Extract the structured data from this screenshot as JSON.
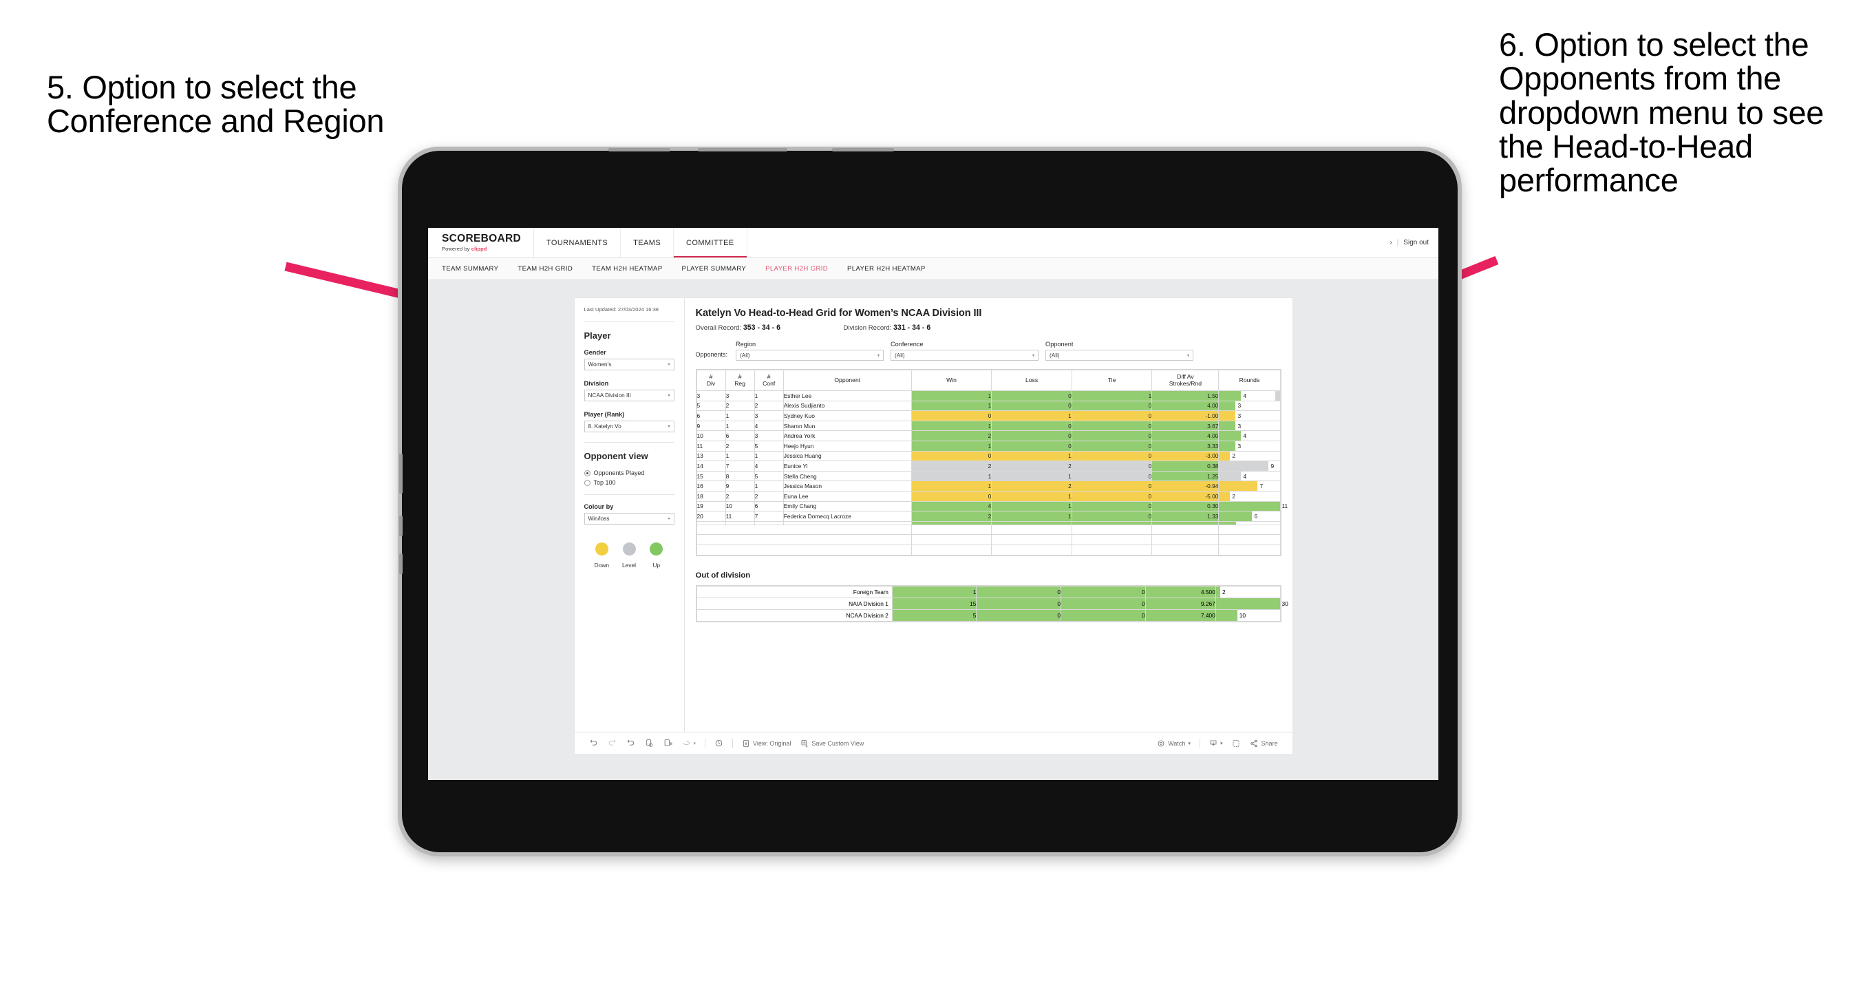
{
  "annotations": {
    "left": "5. Option to select the Conference and Region",
    "right": "6. Option to select the Opponents from the dropdown menu to see the Head-to-Head performance",
    "arrow_color": "#e8225f"
  },
  "appbar": {
    "brand_name": "SCOREBOARD",
    "brand_sub_prefix": "Powered by ",
    "brand_sub_accent": "clippd",
    "nav": [
      {
        "label": "TOURNAMENTS",
        "active": false
      },
      {
        "label": "TEAMS",
        "active": false
      },
      {
        "label": "COMMITTEE",
        "active": true
      }
    ],
    "chevron": "›",
    "separator": "|",
    "signout": "Sign out",
    "accent": "#d12b4e"
  },
  "subnav": {
    "items": [
      {
        "label": "TEAM SUMMARY",
        "active": false
      },
      {
        "label": "TEAM H2H GRID",
        "active": false
      },
      {
        "label": "TEAM H2H HEATMAP",
        "active": false
      },
      {
        "label": "PLAYER SUMMARY",
        "active": false
      },
      {
        "label": "PLAYER H2H GRID",
        "active": true
      },
      {
        "label": "PLAYER H2H HEATMAP",
        "active": false
      }
    ],
    "active_color": "#e0556f"
  },
  "sidebar": {
    "last_updated": "Last Updated: 27/03/2024 16:38",
    "player_heading": "Player",
    "fields": [
      {
        "label": "Gender",
        "value": "Women’s"
      },
      {
        "label": "Division",
        "value": "NCAA Division III"
      },
      {
        "label": "Player (Rank)",
        "value": "8. Katelyn Vo"
      }
    ],
    "opponent_view_heading": "Opponent view",
    "opponent_view_options": [
      {
        "label": "Opponents Played",
        "selected": true
      },
      {
        "label": "Top 100",
        "selected": false
      }
    ],
    "colour_by_label": "Colour by",
    "colour_by_value": "Win/loss",
    "legend": [
      {
        "label": "Down",
        "color": "#f2cf40"
      },
      {
        "label": "Level",
        "color": "#c2c6ca"
      },
      {
        "label": "Up",
        "color": "#82c860"
      }
    ]
  },
  "main": {
    "title": "Katelyn Vo Head-to-Head Grid for Women’s NCAA Division III",
    "overall_record_label": "Overall Record:",
    "overall_record_value": "353 - 34 - 6",
    "division_record_label": "Division Record:",
    "division_record_value": "331 - 34 - 6",
    "filters_label": "Opponents:",
    "filters": [
      {
        "label": "Region",
        "value": "(All)"
      },
      {
        "label": "Conference",
        "value": "(All)"
      },
      {
        "label": "Opponent",
        "value": "(All)"
      }
    ]
  },
  "chart_data": {
    "type": "table",
    "title": "Katelyn Vo Head-to-Head Grid for Women’s NCAA Division III",
    "columns": [
      "# Div",
      "# Reg",
      "# Conf",
      "Opponent",
      "Win",
      "Loss",
      "Tie",
      "Diff Av Strokes/Rnd",
      "Rounds"
    ],
    "rounds_max": 11,
    "rows": [
      {
        "div": "3",
        "reg": "3",
        "conf": "1",
        "opponent": "Esther Lee",
        "win": "1",
        "loss": "0",
        "tie": "1",
        "diff": "1.50",
        "rounds": "4",
        "color": "#93cd72"
      },
      {
        "div": "5",
        "reg": "2",
        "conf": "2",
        "opponent": "Alexis Sudjianto",
        "win": "1",
        "loss": "0",
        "tie": "0",
        "diff": "4.00",
        "rounds": "3",
        "color": "#93cd72"
      },
      {
        "div": "6",
        "reg": "1",
        "conf": "3",
        "opponent": "Sydney Kuo",
        "win": "0",
        "loss": "1",
        "tie": "0",
        "diff": "-1.00",
        "rounds": "3",
        "color": "#f5d04e"
      },
      {
        "div": "9",
        "reg": "1",
        "conf": "4",
        "opponent": "Sharon Mun",
        "win": "1",
        "loss": "0",
        "tie": "0",
        "diff": "3.67",
        "rounds": "3",
        "color": "#93cd72"
      },
      {
        "div": "10",
        "reg": "6",
        "conf": "3",
        "opponent": "Andrea York",
        "win": "2",
        "loss": "0",
        "tie": "0",
        "diff": "4.00",
        "rounds": "4",
        "color": "#93cd72"
      },
      {
        "div": "11",
        "reg": "2",
        "conf": "5",
        "opponent": "Heejo Hyun",
        "win": "1",
        "loss": "0",
        "tie": "0",
        "diff": "3.33",
        "rounds": "3",
        "color": "#93cd72"
      },
      {
        "div": "13",
        "reg": "1",
        "conf": "1",
        "opponent": "Jessica Huang",
        "win": "0",
        "loss": "1",
        "tie": "0",
        "diff": "-3.00",
        "rounds": "2",
        "color": "#f5d04e"
      },
      {
        "div": "14",
        "reg": "7",
        "conf": "4",
        "opponent": "Eunice Yi",
        "win": "2",
        "loss": "2",
        "tie": "0",
        "diff": "0.38",
        "rounds": "9",
        "color": "#d2d4d6",
        "diff_color": "#93cd72"
      },
      {
        "div": "15",
        "reg": "8",
        "conf": "5",
        "opponent": "Stella Cheng",
        "win": "1",
        "loss": "1",
        "tie": "0",
        "diff": "1.25",
        "rounds": "4",
        "color": "#d2d4d6",
        "diff_color": "#93cd72"
      },
      {
        "div": "16",
        "reg": "9",
        "conf": "1",
        "opponent": "Jessica Mason",
        "win": "1",
        "loss": "2",
        "tie": "0",
        "diff": "-0.94",
        "rounds": "7",
        "color": "#f5d04e"
      },
      {
        "div": "18",
        "reg": "2",
        "conf": "2",
        "opponent": "Euna Lee",
        "win": "0",
        "loss": "1",
        "tie": "0",
        "diff": "-5.00",
        "rounds": "2",
        "color": "#f5d04e"
      },
      {
        "div": "19",
        "reg": "10",
        "conf": "6",
        "opponent": "Emily Chang",
        "win": "4",
        "loss": "1",
        "tie": "0",
        "diff": "0.30",
        "rounds": "11",
        "color": "#93cd72"
      },
      {
        "div": "20",
        "reg": "11",
        "conf": "7",
        "opponent": "Federica Domecq Lacroze",
        "win": "2",
        "loss": "1",
        "tie": "0",
        "diff": "1.33",
        "rounds": "6",
        "color": "#93cd72"
      }
    ],
    "out_of_division_title": "Out of division",
    "out_of_division_rounds_max": 30,
    "out_of_division": [
      {
        "name": "Foreign Team",
        "win": "1",
        "loss": "0",
        "tie": "0",
        "diff": "4.500",
        "rounds": "2",
        "color": "#93cd72"
      },
      {
        "name": "NAIA Division 1",
        "win": "15",
        "loss": "0",
        "tie": "0",
        "diff": "9.267",
        "rounds": "30",
        "color": "#93cd72"
      },
      {
        "name": "NCAA Division 2",
        "win": "5",
        "loss": "0",
        "tie": "0",
        "diff": "7.400",
        "rounds": "10",
        "color": "#93cd72"
      }
    ]
  },
  "toolbar": {
    "view_label": "View: Original",
    "save_label": "Save Custom View",
    "watch_label": "Watch",
    "share_label": "Share"
  }
}
